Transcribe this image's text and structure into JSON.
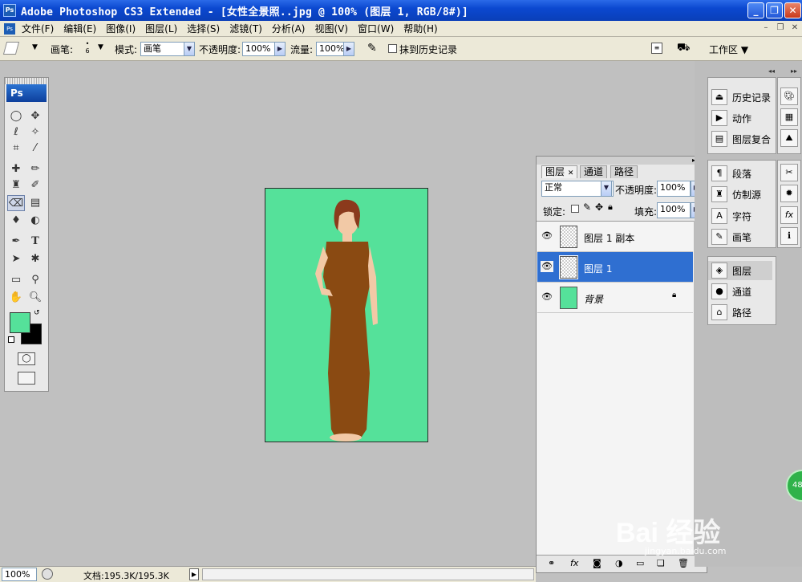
{
  "window": {
    "title": "Adobe Photoshop CS3 Extended - [女性全景照..jpg @ 100% (图层 1, RGB/8#)]",
    "app_icon": "Ps",
    "minimize": "_",
    "restore": "❐",
    "close": "✕"
  },
  "menu": {
    "items": [
      "文件(F)",
      "编辑(E)",
      "图像(I)",
      "图层(L)",
      "选择(S)",
      "滤镜(T)",
      "分析(A)",
      "视图(V)",
      "窗口(W)",
      "帮助(H)"
    ]
  },
  "options": {
    "brush_label": "画笔:",
    "brush_size": "6",
    "mode_label": "模式:",
    "mode_value": "画笔",
    "opacity_label": "不透明度:",
    "opacity_value": "100%",
    "flow_label": "流量:",
    "flow_value": "100%",
    "history_label": "抹到历史记录",
    "workspace_label": "工作区 ▼"
  },
  "toolbox": {
    "logo": "Ps",
    "foreground_color": "#55e19a",
    "background_color": "#000000"
  },
  "canvas": {
    "background_color": "#55e19a",
    "figure_color": "#8a4a12"
  },
  "layers_panel": {
    "tabs": [
      "图层",
      "通道",
      "路径"
    ],
    "blend_mode": "正常",
    "opacity_label": "不透明度:",
    "opacity_value": "100%",
    "lock_label": "锁定:",
    "fill_label": "填充:",
    "fill_value": "100%",
    "layers": [
      {
        "name": "图层 1 副本",
        "selected": false
      },
      {
        "name": "图层 1",
        "selected": true
      },
      {
        "name": "背景",
        "selected": false,
        "locked": true
      }
    ]
  },
  "dock": {
    "group1": [
      "历史记录",
      "动作",
      "图层复合"
    ],
    "group2": [
      "段落",
      "仿制源",
      "字符",
      "画笔"
    ],
    "group3": [
      "图层",
      "通道",
      "路径"
    ]
  },
  "status": {
    "zoom": "100%",
    "doc_info": "文档:195.3K/195.3K"
  },
  "watermark": {
    "text": "Bai 经验",
    "url": "jingyan.baidu.com",
    "badge": "48"
  }
}
